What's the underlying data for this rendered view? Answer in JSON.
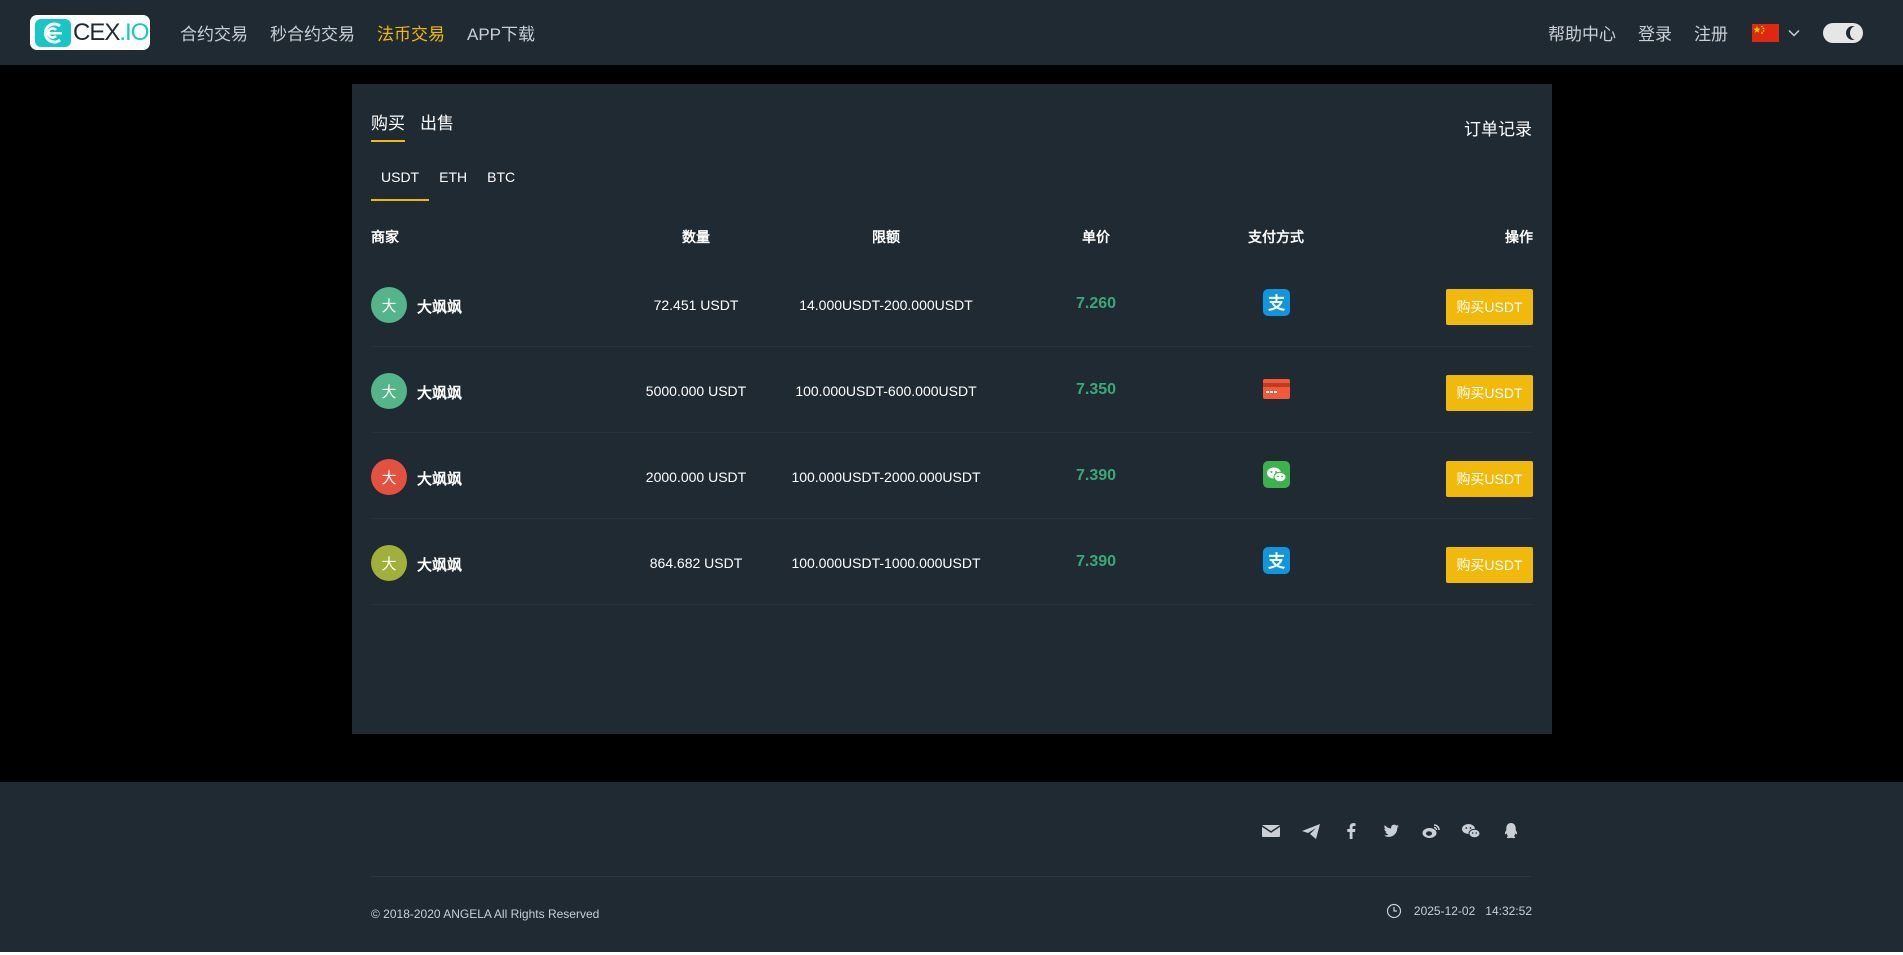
{
  "header": {
    "logo_text_a": "CEX",
    "logo_text_b": ".IO",
    "nav": [
      {
        "label": "合约交易",
        "active": false
      },
      {
        "label": "秒合约交易",
        "active": false
      },
      {
        "label": "法币交易",
        "active": true
      },
      {
        "label": "APP下载",
        "active": false
      }
    ],
    "help": "帮助中心",
    "login": "登录",
    "register": "注册"
  },
  "panel": {
    "side_tabs": [
      "购买",
      "出售"
    ],
    "order_records": "订单记录",
    "coin_tabs": [
      "USDT",
      "ETH",
      "BTC"
    ],
    "columns": {
      "merchant": "商家",
      "quantity": "数量",
      "limit": "限额",
      "price": "单价",
      "payment": "支付方式",
      "action": "操作"
    },
    "rows": [
      {
        "avatar": "大",
        "avatar_color": "#55b58a",
        "merchant": "大飒飒",
        "quantity": "72.451 USDT",
        "limit": "14.000USDT-200.000USDT",
        "price": "7.260",
        "payment": "alipay-icon",
        "button": "购买USDT"
      },
      {
        "avatar": "大",
        "avatar_color": "#55b58a",
        "merchant": "大飒飒",
        "quantity": "5000.000 USDT",
        "limit": "100.000USDT-600.000USDT",
        "price": "7.350",
        "payment": "bank-card-icon",
        "button": "购买USDT"
      },
      {
        "avatar": "大",
        "avatar_color": "#e4523f",
        "merchant": "大飒飒",
        "quantity": "2000.000 USDT",
        "limit": "100.000USDT-2000.000USDT",
        "price": "7.390",
        "payment": "wechat-pay-icon",
        "button": "购买USDT"
      },
      {
        "avatar": "大",
        "avatar_color": "#a0b03a",
        "merchant": "大飒飒",
        "quantity": "864.682 USDT",
        "limit": "100.000USDT-1000.000USDT",
        "price": "7.390",
        "payment": "alipay-icon",
        "button": "购买USDT"
      }
    ]
  },
  "footer": {
    "social": [
      "mail-icon",
      "telegram-icon",
      "facebook-icon",
      "twitter-icon",
      "weibo-icon",
      "wechat-icon",
      "qq-icon"
    ],
    "copyright": "© 2018-2020 ANGELA All Rights Reserved",
    "date": "2025-12-02",
    "time": "14:32:52"
  },
  "colors": {
    "accent": "#f0b90b",
    "price_green": "#3ba87a",
    "panel_bg": "#1f2a33"
  }
}
